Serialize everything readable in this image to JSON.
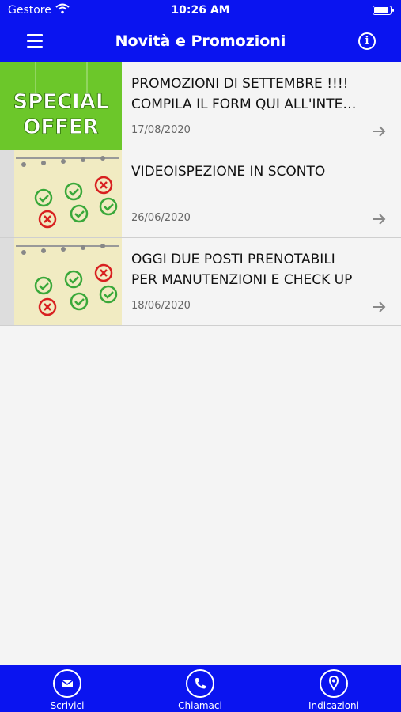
{
  "status": {
    "carrier": "Gestore",
    "time": "10:26 AM",
    "battery_level": 0.95
  },
  "header": {
    "title": "Novità e Promozioni"
  },
  "items": [
    {
      "line1": "PROMOZIONI DI SETTEMBRE !!!!",
      "line2": "COMPILA IL FORM QUI ALL'INTE…",
      "date": "17/08/2020",
      "thumb_text_1": "SPECIAL",
      "thumb_text_2": "OFFER"
    },
    {
      "line1": "VIDEOISPEZIONE IN SCONTO",
      "line2": "",
      "date": "26/06/2020"
    },
    {
      "line1": "OGGI DUE POSTI PRENOTABILI",
      "line2": "PER MANUTENZIONI E CHECK UP",
      "date": "18/06/2020"
    }
  ],
  "tabs": [
    {
      "label": "Scrivici",
      "icon": "mail-icon"
    },
    {
      "label": "Chiamaci",
      "icon": "phone-icon"
    },
    {
      "label": "Indicazioni",
      "icon": "location-pin-icon"
    }
  ],
  "colors": {
    "brand_blue": "#0a14f0",
    "background": "#f4f4f4",
    "offer_green": "#6cc72a"
  }
}
